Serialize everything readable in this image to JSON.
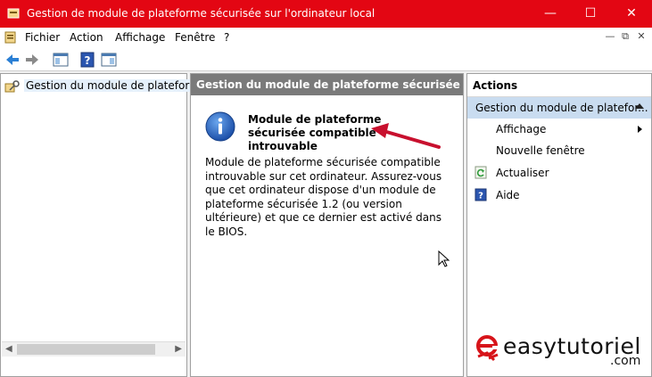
{
  "window": {
    "title": "Gestion de module de plateforme sécurisée sur l'ordinateur local",
    "accent": "#e30613",
    "controls": {
      "minimize": "—",
      "maximize": "☐",
      "close": "✕"
    }
  },
  "menubar": {
    "items": [
      "Fichier",
      "Action",
      "Affichage",
      "Fenêtre",
      "?"
    ],
    "mdi_controls": {
      "minimize": "—",
      "restore": "⧉",
      "close": "✕"
    }
  },
  "toolbar": {
    "icons": [
      "back-arrow-icon",
      "forward-arrow-icon",
      "show-hide-console-tree-icon",
      "help-icon",
      "show-hide-action-pane-icon"
    ]
  },
  "tree": {
    "items": [
      {
        "label": "Gestion du module de plateforme",
        "icon": "tpm-key-icon"
      }
    ]
  },
  "center": {
    "header": "Gestion du module de plateforme sécurisée sur l'o...",
    "info_title": "Module de plateforme sécurisée compatible introuvable",
    "info_text": "Module de plateforme sécurisée compatible introuvable sur cet ordinateur. Assurez-vous que cet ordinateur dispose d'un module de plateforme sécurisée 1.2 (ou version ultérieure) et que ce dernier est activé dans le BIOS.",
    "annotation_color": "#c8102e"
  },
  "actions": {
    "header": "Actions",
    "section": "Gestion du module de platefor...",
    "items": [
      {
        "label": "Affichage",
        "icon": "",
        "submenu": true
      },
      {
        "label": "Nouvelle fenêtre",
        "icon": "",
        "submenu": false
      },
      {
        "label": "Actualiser",
        "icon": "refresh-icon",
        "submenu": false
      },
      {
        "label": "Aide",
        "icon": "help-icon",
        "submenu": false
      }
    ]
  },
  "watermark": {
    "text": "easytutoriel",
    "suffix": ".com",
    "brand_color": "#d7141a"
  }
}
